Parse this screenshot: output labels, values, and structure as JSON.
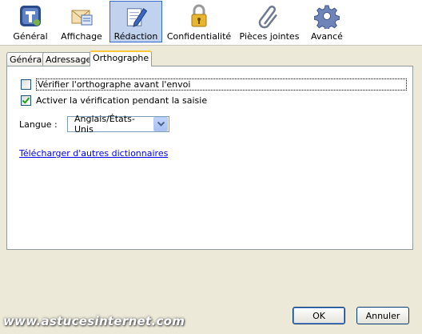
{
  "toolbar": {
    "items": [
      {
        "label": "Général",
        "icon": "thunderbird-icon"
      },
      {
        "label": "Affichage",
        "icon": "display-envelope-icon"
      },
      {
        "label": "Rédaction",
        "icon": "compose-pencil-icon",
        "selected": true
      },
      {
        "label": "Confidentialité",
        "icon": "padlock-icon"
      },
      {
        "label": "Pièces jointes",
        "icon": "paperclip-icon"
      },
      {
        "label": "Avancé",
        "icon": "gear-icon"
      }
    ]
  },
  "tabs": [
    {
      "label": "Général"
    },
    {
      "label": "Adressage"
    },
    {
      "label": "Orthographe",
      "active": true
    }
  ],
  "options": {
    "check_before_send": {
      "label": "Vérifier l'orthographe avant l'envoi",
      "checked": false
    },
    "check_while_typing": {
      "label": "Activer la vérification pendant la saisie",
      "checked": true
    }
  },
  "language": {
    "label": "Langue :",
    "selected": "Anglais/États-Unis"
  },
  "download_link": "Télécharger d'autres dictionnaires",
  "buttons": {
    "ok": "OK",
    "cancel": "Annuler"
  },
  "watermark": "www.astucesinternet.com",
  "colors": {
    "selection": "#c1d2ee",
    "tab_highlight": "#ffc83c",
    "window_bg": "#ece9d8"
  }
}
